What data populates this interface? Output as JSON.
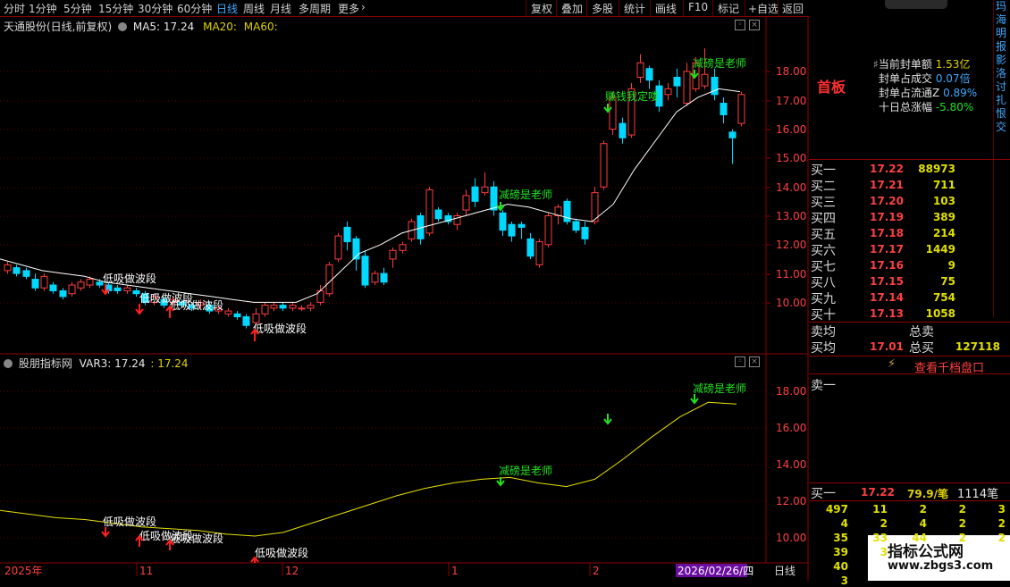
{
  "toolbar": {
    "period_tabs": [
      "分时",
      "1分钟",
      "5分钟",
      "15分钟",
      "30分钟",
      "60分钟",
      "日线",
      "周线",
      "月线",
      "多周期",
      "更多"
    ],
    "active_tab": "日线",
    "actions": [
      "复权",
      "叠加",
      "多股",
      "统计",
      "画线",
      "F10",
      "标记",
      "+自选",
      "返回"
    ]
  },
  "chart": {
    "stock_name": "天通股份(日线,前复权)",
    "ma5_label": "MA5: 17.24",
    "ma20_label": "MA20:",
    "ma60_label": "MA60:",
    "y_ticks": [
      "18.00",
      "17.00",
      "16.00",
      "15.00",
      "14.00",
      "13.00",
      "12.00",
      "11.00",
      "10.00"
    ],
    "annotations": {
      "dip_label": "低吸做波段",
      "teacher_label": "减磅是老师",
      "profit_label": "赚钱我定喽"
    }
  },
  "indicator": {
    "name": "股朋指标网",
    "var_label": "VAR3: 17.24",
    "var_value": ": 17.24",
    "y_ticks": [
      "18.00",
      "16.00",
      "14.00",
      "12.00",
      "10.00"
    ]
  },
  "time_axis": {
    "labels": [
      "2025年",
      "11",
      "12",
      "1",
      "2"
    ],
    "cursor_date": "2026/02/26/四",
    "period": "日线"
  },
  "chart_data": {
    "type": "candlestick",
    "ma_line": [
      11.5,
      11.3,
      11.1,
      11.0,
      10.9,
      10.7,
      10.6,
      10.5,
      10.4,
      10.3,
      10.2,
      10.1,
      10.0,
      10.0,
      10.0,
      10.3,
      11.0,
      11.7,
      12.0,
      12.4,
      12.6,
      12.8,
      13.0,
      13.2,
      13.4,
      13.3,
      13.1,
      12.9,
      12.8,
      13.4,
      14.6,
      15.6,
      16.6,
      17.1,
      17.4,
      17.3
    ],
    "var3_line": [
      11.5,
      11.3,
      11.1,
      11.0,
      10.8,
      10.6,
      10.5,
      10.4,
      10.2,
      10.1,
      10.3,
      10.8,
      11.3,
      11.8,
      12.3,
      12.7,
      13.0,
      13.2,
      13.3,
      13.0,
      12.8,
      13.2,
      14.3,
      15.5,
      16.6,
      17.4,
      17.3
    ]
  },
  "right_panel": {
    "board_type": "首板",
    "stats": [
      {
        "label": "当前封单额",
        "value": "1.53亿"
      },
      {
        "label": "封单占成交",
        "value": "0.07倍"
      },
      {
        "label": "封单占流通Z",
        "value": "0.89%"
      },
      {
        "label": "十日总涨幅",
        "value": "-5.80%"
      }
    ],
    "bids": [
      {
        "label": "买一",
        "price": "17.22",
        "vol": "88973"
      },
      {
        "label": "买二",
        "price": "17.21",
        "vol": "711"
      },
      {
        "label": "买三",
        "price": "17.20",
        "vol": "103"
      },
      {
        "label": "买四",
        "price": "17.19",
        "vol": "389"
      },
      {
        "label": "买五",
        "price": "17.18",
        "vol": "214"
      },
      {
        "label": "买六",
        "price": "17.17",
        "vol": "1449"
      },
      {
        "label": "买七",
        "price": "17.16",
        "vol": "9"
      },
      {
        "label": "买八",
        "price": "17.15",
        "vol": "75"
      },
      {
        "label": "买九",
        "price": "17.14",
        "vol": "754"
      },
      {
        "label": "买十",
        "price": "17.13",
        "vol": "1058"
      }
    ],
    "sell_avg_label": "卖均",
    "total_sell_label": "总卖",
    "buy_avg_label": "买均",
    "buy_avg": "17.01",
    "total_buy_label": "总买",
    "total_buy": "127118",
    "view_depth": "查看千档盘口",
    "sell1_label": "卖一",
    "buy1_label": "买一",
    "buy1_price": "17.22",
    "buy1_per": "79.9/笔",
    "buy1_count": "1114笔",
    "queue_rows": [
      [
        "497",
        "11",
        "2",
        "2",
        "3"
      ],
      [
        "4",
        "2",
        "4",
        "2",
        "2"
      ],
      [
        "35",
        "33",
        "44",
        "2",
        "2"
      ],
      [
        "39",
        "3",
        "",
        "",
        ""
      ],
      [
        "40",
        "",
        "",
        "",
        ""
      ],
      [
        "3",
        "",
        "",
        "",
        ""
      ]
    ],
    "watermark_title": "指标公式网",
    "watermark_url": "www.zbgs3.com"
  }
}
